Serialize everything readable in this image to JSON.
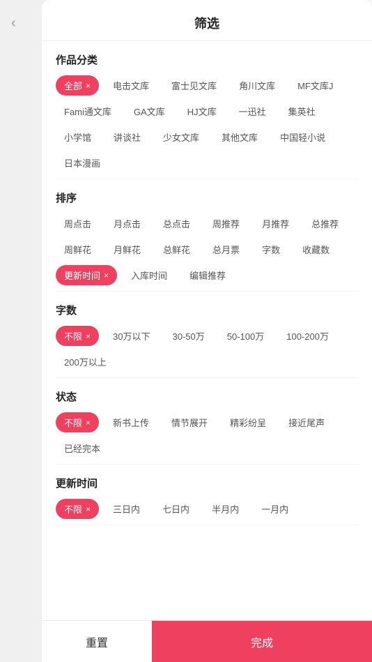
{
  "header": {
    "title": "筛选",
    "back_icon": "‹"
  },
  "sections": [
    {
      "id": "category",
      "title": "作品分类",
      "tags": [
        {
          "label": "全部",
          "active": true,
          "closable": true
        },
        {
          "label": "电击文库",
          "active": false
        },
        {
          "label": "富士见文库",
          "active": false
        },
        {
          "label": "角川文库",
          "active": false
        },
        {
          "label": "MF文库J",
          "active": false
        },
        {
          "label": "Fami通文库",
          "active": false
        },
        {
          "label": "GA文库",
          "active": false
        },
        {
          "label": "HJ文库",
          "active": false
        },
        {
          "label": "一迅社",
          "active": false
        },
        {
          "label": "集英社",
          "active": false
        },
        {
          "label": "小学馆",
          "active": false
        },
        {
          "label": "讲谈社",
          "active": false
        },
        {
          "label": "少女文库",
          "active": false
        },
        {
          "label": "其他文库",
          "active": false
        },
        {
          "label": "中国轻小说",
          "active": false
        },
        {
          "label": "日本漫画",
          "active": false
        }
      ]
    },
    {
      "id": "sort",
      "title": "排序",
      "tags": [
        {
          "label": "周点击",
          "active": false
        },
        {
          "label": "月点击",
          "active": false
        },
        {
          "label": "总点击",
          "active": false
        },
        {
          "label": "周推荐",
          "active": false
        },
        {
          "label": "月推荐",
          "active": false
        },
        {
          "label": "总推荐",
          "active": false
        },
        {
          "label": "周鲜花",
          "active": false
        },
        {
          "label": "月鲜花",
          "active": false
        },
        {
          "label": "总鲜花",
          "active": false
        },
        {
          "label": "总月票",
          "active": false
        },
        {
          "label": "字数",
          "active": false
        },
        {
          "label": "收藏数",
          "active": false
        },
        {
          "label": "更新时间",
          "active": true,
          "closable": true
        },
        {
          "label": "入库时间",
          "active": false
        },
        {
          "label": "编辑推荐",
          "active": false
        }
      ]
    },
    {
      "id": "wordcount",
      "title": "字数",
      "tags": [
        {
          "label": "不限",
          "active": true,
          "closable": true
        },
        {
          "label": "30万以下",
          "active": false
        },
        {
          "label": "30-50万",
          "active": false
        },
        {
          "label": "50-100万",
          "active": false
        },
        {
          "label": "100-200万",
          "active": false
        },
        {
          "label": "200万以上",
          "active": false
        }
      ]
    },
    {
      "id": "status",
      "title": "状态",
      "tags": [
        {
          "label": "不限",
          "active": true,
          "closable": true
        },
        {
          "label": "新书上传",
          "active": false
        },
        {
          "label": "情节展开",
          "active": false
        },
        {
          "label": "精彩纷呈",
          "active": false
        },
        {
          "label": "接近尾声",
          "active": false
        },
        {
          "label": "已经完本",
          "active": false
        }
      ]
    },
    {
      "id": "updatetime",
      "title": "更新时间",
      "tags": [
        {
          "label": "不限",
          "active": true,
          "closable": true
        },
        {
          "label": "三日内",
          "active": false
        },
        {
          "label": "七日内",
          "active": false
        },
        {
          "label": "半月内",
          "active": false
        },
        {
          "label": "一月内",
          "active": false
        }
      ]
    }
  ],
  "footer": {
    "reset_label": "重置",
    "confirm_label": "完成"
  },
  "colors": {
    "active_bg": "#f04060",
    "active_text": "#ffffff",
    "confirm_bg": "#f04060"
  }
}
